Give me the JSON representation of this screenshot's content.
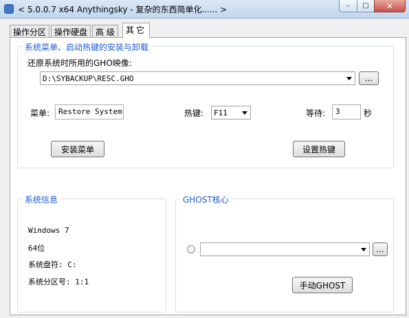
{
  "window": {
    "title": "< 5.0.0.7 x64 Anythingsky - 复杂的东西简单化...... >",
    "minimize_glyph": "–",
    "maximize_glyph": "□",
    "close_glyph": "✕"
  },
  "tabs": [
    {
      "label": "操作分区"
    },
    {
      "label": "操作硬盘"
    },
    {
      "label": "高 级"
    },
    {
      "label": "其它"
    }
  ],
  "menu_hotkey_group": {
    "title": "系统菜单、启动热键的安装与卸载",
    "gho_label": "还原系统时所用的GHO映像:",
    "gho_path": "D:\\SYBACKUP\\RESC.GHO",
    "browse_label": "...",
    "menu_label": "菜单:",
    "menu_value": "Restore System",
    "hotkey_label": "热键:",
    "hotkey_value": "F11",
    "wait_label": "等待:",
    "wait_value": "3",
    "wait_unit": "秒",
    "install_menu_label": "安装菜单",
    "set_hotkey_label": "设置热键"
  },
  "system_info": {
    "title": "系统信息",
    "os": "Windows 7",
    "bits": "64位",
    "drive": "系统盘符: C:",
    "partition": "系统分区号: 1:1"
  },
  "ghost_core": {
    "title": "GHOST核心",
    "combo_value": "",
    "browse_label": "...",
    "manual_ghost_label": "手动GHOST"
  }
}
